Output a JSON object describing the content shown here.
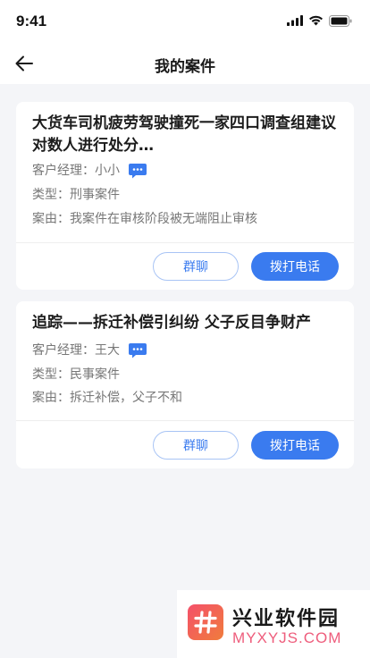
{
  "status_bar": {
    "time": "9:41"
  },
  "nav": {
    "title": "我的案件"
  },
  "cases": [
    {
      "title": "大货车司机疲劳驾驶撞死一家四口调查组建议对数人进行处分…",
      "manager_label": "客户经理：",
      "manager": "小小",
      "type_label": "类型：",
      "type": "刑事案件",
      "reason_label": "案由：",
      "reason": "我案件在审核阶段被无端阻止审核",
      "group_button": "群聊",
      "call_button": "拨打电话"
    },
    {
      "title": "追踪——拆迁补偿引纠纷 父子反目争财产",
      "manager_label": "客户经理：",
      "manager": "王大",
      "type_label": "类型：",
      "type": "民事案件",
      "reason_label": "案由：",
      "reason": "拆迁补偿，父子不和",
      "group_button": "群聊",
      "call_button": "拨打电话"
    }
  ],
  "watermark": {
    "name": "兴业软件园",
    "url": "MYXYJS.COM"
  },
  "colors": {
    "accent": "#3a7bef",
    "background": "#f4f5f8"
  }
}
